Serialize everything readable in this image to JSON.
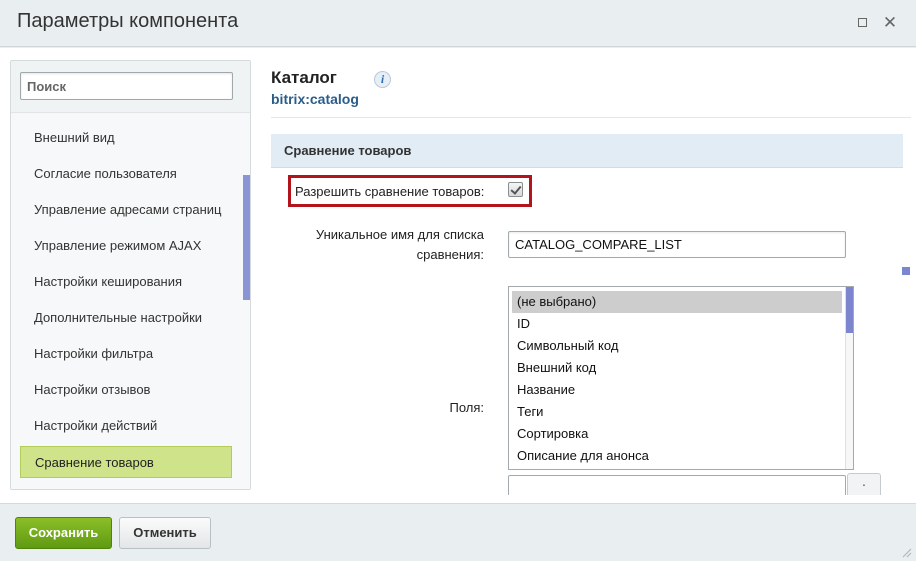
{
  "window": {
    "title": "Параметры компонента",
    "maximize_icon": "maximize-icon",
    "close_icon": "close-icon",
    "close_glyph": "✕"
  },
  "sidebar": {
    "search_placeholder": "Поиск",
    "items": [
      {
        "label": "Внешний вид",
        "active": false
      },
      {
        "label": "Согласие пользователя",
        "active": false
      },
      {
        "label": "Управление адресами страниц",
        "active": false
      },
      {
        "label": "Управление режимом AJAX",
        "active": false
      },
      {
        "label": "Настройки кеширования",
        "active": false
      },
      {
        "label": "Дополнительные настройки",
        "active": false
      },
      {
        "label": "Настройки фильтра",
        "active": false
      },
      {
        "label": "Настройки отзывов",
        "active": false
      },
      {
        "label": "Настройки действий",
        "active": false
      },
      {
        "label": "Сравнение товаров",
        "active": true
      }
    ]
  },
  "component": {
    "title": "Каталог",
    "code": "bitrix:catalog",
    "info_icon": "info-icon",
    "info_glyph": "i"
  },
  "section": {
    "title": "Сравнение товаров",
    "allow_compare": {
      "label": "Разрешить сравнение товаров:",
      "checked": true
    },
    "unique_name": {
      "label_line1": "Уникальное имя для списка",
      "label_line2": "сравнения:",
      "value": "CATALOG_COMPARE_LIST"
    },
    "fields": {
      "label": "Поля:",
      "options": [
        {
          "label": "(не выбрано)",
          "selected": true
        },
        {
          "label": "ID",
          "selected": false
        },
        {
          "label": "Символьный код",
          "selected": false
        },
        {
          "label": "Внешний код",
          "selected": false
        },
        {
          "label": "Название",
          "selected": false
        },
        {
          "label": "Теги",
          "selected": false
        },
        {
          "label": "Сортировка",
          "selected": false
        },
        {
          "label": "Описание для анонса",
          "selected": false
        }
      ]
    }
  },
  "footer": {
    "save_label": "Сохранить",
    "cancel_label": "Отменить"
  },
  "colors": {
    "accent_green": "#5f9a12",
    "active_item": "#cfe38a",
    "highlight_border": "#b3131a",
    "link_blue": "#2a5d8a"
  }
}
